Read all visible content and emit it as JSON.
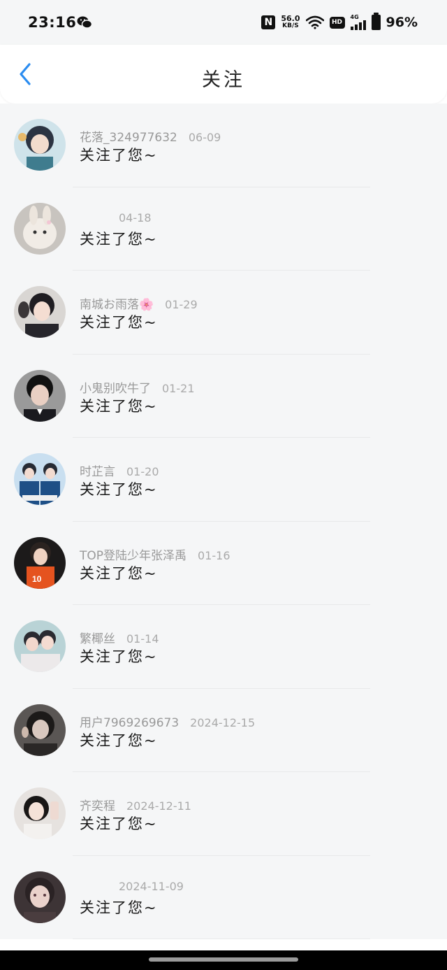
{
  "status_bar": {
    "time": "23:16",
    "speed_value": "56.0",
    "speed_unit": "KB/S",
    "hd": "HD",
    "network": "4G",
    "battery": "96%"
  },
  "header": {
    "title": "关注",
    "back_icon": "chevron-left-icon"
  },
  "items": [
    {
      "name": "花落_324977632",
      "date": "06-09",
      "message": "关注了您~"
    },
    {
      "name": "",
      "date": "04-18",
      "message": "关注了您~"
    },
    {
      "name": "南城お雨落🌸",
      "date": "01-29",
      "message": "关注了您~"
    },
    {
      "name": "小鬼别吹牛了",
      "date": "01-21",
      "message": "关注了您~"
    },
    {
      "name": "时芷言",
      "date": "01-20",
      "message": "关注了您~"
    },
    {
      "name": "TOP登陆少年张泽禹",
      "date": "01-16",
      "message": "关注了您~"
    },
    {
      "name": "繁椰丝",
      "date": "01-14",
      "message": "关注了您~"
    },
    {
      "name": "用户7969269673",
      "date": "2024-12-15",
      "message": "关注了您~"
    },
    {
      "name": "齐奕程",
      "date": "2024-12-11",
      "message": "关注了您~"
    },
    {
      "name": "",
      "date": "2024-11-09",
      "message": "关注了您~"
    }
  ],
  "colors": {
    "accent": "#2a8cf0",
    "list_background": "#f5f6f7",
    "meta_text": "#999999"
  }
}
